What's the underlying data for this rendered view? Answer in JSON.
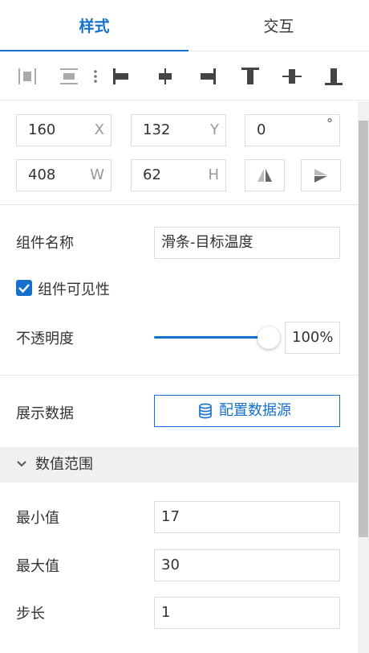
{
  "tabs": {
    "style_label": "样式",
    "interaction_label": "交互"
  },
  "toolbar": {
    "items": [
      "distribute-horizontal-icon",
      "distribute-vertical-icon",
      "more-vertical-icon",
      "align-left-icon",
      "align-center-horizontal-icon",
      "align-right-icon",
      "align-top-icon",
      "align-middle-vertical-icon",
      "align-bottom-icon"
    ]
  },
  "geometry": {
    "x_value": "160",
    "x_unit": "X",
    "y_value": "132",
    "y_unit": "Y",
    "rotation_value": "0",
    "rotation_unit": "°",
    "w_value": "408",
    "w_unit": "W",
    "h_value": "62",
    "h_unit": "H"
  },
  "component_name": {
    "label": "组件名称",
    "value": "滑条-目标温度"
  },
  "visibility": {
    "label": "组件可见性",
    "checked": true
  },
  "opacity": {
    "label": "不透明度",
    "value": "100%",
    "level": 100
  },
  "data_source": {
    "label": "展示数据",
    "button_label": "配置数据源"
  },
  "value_range": {
    "section_title": "数值范围",
    "min_label": "最小值",
    "min_value": "17",
    "max_label": "最大值",
    "max_value": "30",
    "step_label": "步长",
    "step_value": "1"
  },
  "colors": {
    "accent": "#1470cc",
    "border": "#dcdcdc",
    "section_bg": "#f0f0f0"
  }
}
